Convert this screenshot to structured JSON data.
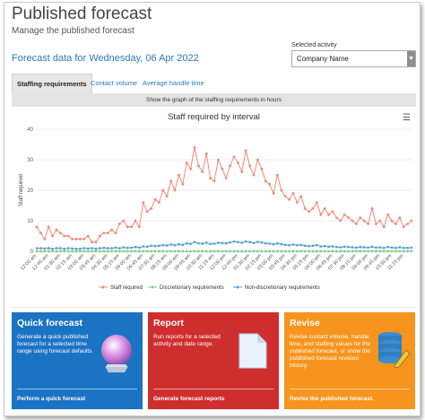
{
  "header": {
    "title": "Published forecast",
    "subtitle": "Manage the published forecast",
    "forecast_date": "Forecast data for Wednesday, 06 Apr 2022"
  },
  "activity": {
    "label": "Selected activity",
    "selected": "Company Name"
  },
  "tabs": [
    {
      "label": "Staffing requirements",
      "active": true
    },
    {
      "label": "Contact volume",
      "active": false
    },
    {
      "label": "Average handle time",
      "active": false
    }
  ],
  "graph_band": "Show the graph of the staffing requirements in hours",
  "chart": {
    "title": "Staff required by interval",
    "ylabel": "Staff required",
    "menu_icon": "hamburger-icon"
  },
  "chart_data": {
    "type": "line",
    "title": "Staff required by interval",
    "ylabel": "Staff required",
    "xlabel": "",
    "ylim": [
      0,
      40
    ],
    "yticks": [
      0,
      10,
      20,
      30,
      40
    ],
    "grid": true,
    "legend": "bottom",
    "x": [
      "12:00 am",
      "12:15 am",
      "12:30 am",
      "12:45 am",
      "01:00 am",
      "01:15 am",
      "01:30 am",
      "01:45 am",
      "02:00 am",
      "02:15 am",
      "02:30 am",
      "02:45 am",
      "03:00 am",
      "03:15 am",
      "03:30 am",
      "03:45 am",
      "04:00 am",
      "04:15 am",
      "04:30 am",
      "04:45 am",
      "05:00 am",
      "05:15 am",
      "05:30 am",
      "05:45 am",
      "06:00 am",
      "06:15 am",
      "06:30 am",
      "06:45 am",
      "07:00 am",
      "07:15 am",
      "07:30 am",
      "07:45 am",
      "08:00 am",
      "08:15 am",
      "08:30 am",
      "08:45 am",
      "09:00 am",
      "09:15 am",
      "09:30 am",
      "09:45 am",
      "10:00 am",
      "10:15 am",
      "10:30 am",
      "10:45 am",
      "11:00 am",
      "11:15 am",
      "11:30 am",
      "11:45 am",
      "12:00 pm",
      "12:15 pm",
      "12:30 pm",
      "12:45 pm",
      "01:00 pm",
      "01:15 pm",
      "01:30 pm",
      "01:45 pm",
      "02:00 pm",
      "02:15 pm",
      "02:30 pm",
      "02:45 pm",
      "03:00 pm",
      "03:15 pm",
      "03:30 pm",
      "03:45 pm",
      "04:00 pm",
      "04:15 pm",
      "04:30 pm",
      "04:45 pm",
      "05:00 pm",
      "05:15 pm",
      "05:30 pm",
      "05:45 pm",
      "06:00 pm",
      "06:15 pm",
      "06:30 pm",
      "06:45 pm",
      "07:00 pm",
      "07:15 pm",
      "07:30 pm",
      "07:45 pm",
      "08:00 pm",
      "08:15 pm",
      "08:30 pm",
      "08:45 pm",
      "09:00 pm",
      "09:15 pm",
      "09:30 pm",
      "09:45 pm",
      "10:00 pm",
      "10:15 pm",
      "10:30 pm",
      "10:45 pm",
      "11:00 pm",
      "11:15 pm",
      "11:30 pm",
      "11:45 pm"
    ],
    "xtick_labels": [
      "12:00 am",
      "12:45 am",
      "01:30 am",
      "02:15 am",
      "03:00 am",
      "03:45 am",
      "04:30 am",
      "05:15 am",
      "06:00 am",
      "06:45 am",
      "07:30 am",
      "08:15 am",
      "09:00 am",
      "09:45 am",
      "10:30 am",
      "11:15 am",
      "12:00 pm",
      "12:45 pm",
      "01:30 pm",
      "02:15 pm",
      "03:00 pm",
      "03:45 pm",
      "04:30 pm",
      "05:15 pm",
      "06:00 pm",
      "06:45 pm",
      "07:30 pm",
      "08:15 pm",
      "09:00 pm",
      "09:45 pm",
      "10:30 pm",
      "11:15 pm"
    ],
    "series": [
      {
        "name": "Staff required",
        "color": "#f08a78",
        "values": [
          8,
          6,
          4,
          8,
          5,
          7,
          6,
          5,
          5,
          4,
          4,
          4,
          4,
          5,
          3,
          3,
          5,
          6,
          6,
          7,
          6,
          9,
          10,
          8,
          8,
          10,
          8,
          16,
          13,
          14,
          17,
          16,
          20,
          18,
          23,
          20,
          25,
          22,
          29,
          27,
          34,
          28,
          26,
          32,
          24,
          23,
          30,
          27,
          24,
          28,
          31,
          29,
          26,
          33,
          28,
          25,
          30,
          27,
          23,
          22,
          19,
          25,
          20,
          18,
          17,
          19,
          16,
          18,
          14,
          13,
          14,
          16,
          12,
          14,
          12,
          13,
          11,
          10,
          12,
          11,
          10,
          9,
          11,
          10,
          9,
          14,
          9,
          10,
          8,
          12,
          10,
          9,
          11,
          8,
          9,
          10
        ]
      },
      {
        "name": "Discretionary requirements",
        "color": "#7fc98a",
        "values": [
          0,
          0,
          0,
          0,
          0,
          0,
          0,
          0,
          0,
          0,
          0,
          0,
          0,
          0,
          0,
          0,
          0,
          0,
          0,
          0,
          0,
          0,
          0,
          0,
          0,
          0,
          0,
          0,
          0,
          0,
          0,
          0,
          0,
          0,
          0,
          0,
          0,
          0,
          0,
          0,
          0,
          0,
          0,
          0,
          0,
          0,
          0,
          0,
          0,
          0,
          0,
          0,
          0,
          0,
          0,
          0,
          0,
          0,
          0,
          0,
          0,
          0,
          0,
          0,
          0,
          0,
          0,
          0,
          0,
          0,
          0,
          0,
          0,
          0,
          0,
          0,
          0,
          0,
          0,
          0,
          0,
          0,
          0,
          0,
          0,
          0,
          0,
          0,
          0,
          0,
          0,
          0,
          0,
          0,
          0,
          0
        ]
      },
      {
        "name": "Non-discretionary requirements",
        "color": "#5a9fd4",
        "values": [
          1,
          1,
          0.9,
          1,
          0.8,
          1,
          1,
          0.8,
          1,
          0.9,
          0.8,
          0.8,
          1,
          0.9,
          1,
          0.8,
          1,
          1.1,
          1,
          1,
          1.2,
          1,
          1.3,
          1.1,
          1.2,
          1.4,
          1.2,
          1.6,
          1.5,
          1.8,
          1.7,
          1.8,
          2,
          1.9,
          2.2,
          2,
          2.3,
          2.1,
          2.6,
          2.4,
          3,
          2.6,
          2.5,
          2.8,
          2.4,
          2.5,
          2.8,
          2.7,
          2.6,
          2.9,
          3.2,
          3,
          2.8,
          3.2,
          3,
          2.7,
          3.1,
          2.9,
          2.6,
          2.5,
          2.3,
          2.6,
          2.3,
          2.1,
          2,
          2.2,
          2,
          2.1,
          1.8,
          1.7,
          1.8,
          2,
          1.6,
          1.7,
          1.5,
          1.6,
          1.4,
          1.3,
          1.5,
          1.4,
          1.3,
          1.2,
          1.4,
          1.3,
          1.2,
          1.5,
          1.2,
          1.3,
          1.1,
          1.4,
          1.2,
          1.1,
          1.3,
          1.1,
          1.1,
          1.2
        ]
      }
    ]
  },
  "cards": {
    "quick": {
      "title": "Quick forecast",
      "desc": "Generate a quick published forecast for a selected time range using forecast defaults",
      "link": "Perform a quick forecast",
      "color": "#1b73c4",
      "icon": "crystal-ball-icon"
    },
    "report": {
      "title": "Report",
      "desc": "Run reports for a selected activity and date range.",
      "link": "Generate forecast reports",
      "color": "#cf2e2e",
      "icon": "document-icon"
    },
    "revise": {
      "title": "Revise",
      "desc": "Revise contact volume, handle time, and staffing values for the published forecast, or show the published forecast revision history.",
      "link": "Revise the published forecast.",
      "color": "#f7941d",
      "icon": "database-edit-icon"
    }
  }
}
